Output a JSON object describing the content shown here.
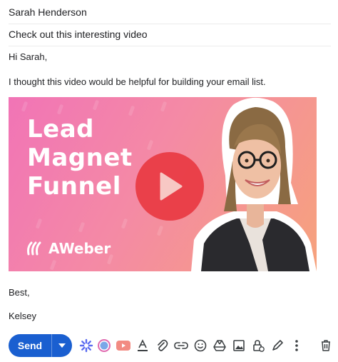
{
  "compose": {
    "to": "Sarah Henderson",
    "subject": "Check out this interesting video"
  },
  "message": {
    "greeting": "Hi Sarah,",
    "line1": "I thought this video would be helpful for building your email list.",
    "signoff": "Best,",
    "signature": "Kelsey"
  },
  "video": {
    "title_line1": "Lead",
    "title_line2": "Magnet",
    "title_line3": "Funnel",
    "brand": "AWeber"
  },
  "toolbar": {
    "send_label": "Send",
    "icons": [
      "send-options-icon",
      "ai-spark-icon",
      "color-circle-icon",
      "youtube-icon",
      "text-format-icon",
      "attach-icon",
      "link-icon",
      "emoji-icon",
      "drive-icon",
      "image-icon",
      "confidential-icon",
      "signature-icon",
      "more-icon",
      "delete-icon"
    ]
  },
  "colors": {
    "send_button": "#1a5fd0",
    "play_button": "#e83a42",
    "thumb_pink": "#f174b6",
    "thumb_orange": "#f6a27c"
  }
}
